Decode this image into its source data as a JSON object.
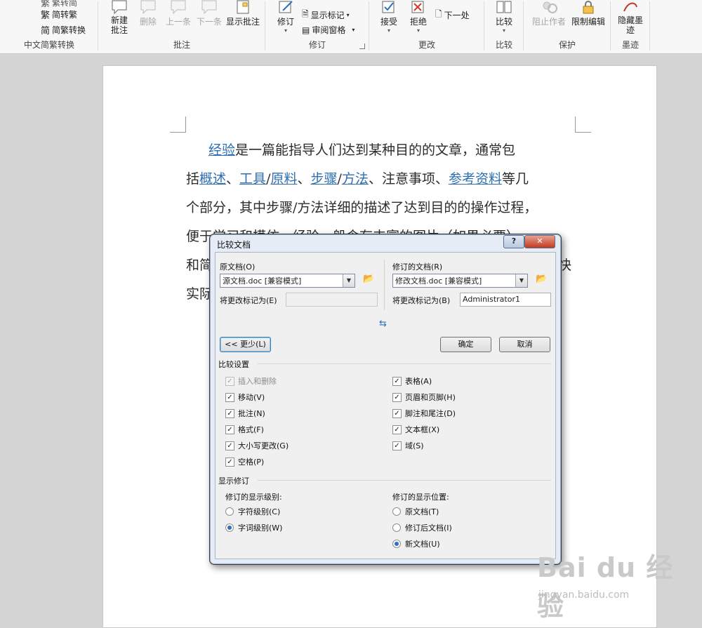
{
  "ribbon": {
    "lang": {
      "label": "中文简繁转换",
      "row1": "简转繁",
      "row2": "简繁转换",
      "top_partial": "繁转简"
    },
    "comments": {
      "label": "批注",
      "new_comment": "新建\n批注",
      "delete": "删除",
      "prev": "上一条",
      "next": "下一条",
      "show": "显示批注"
    },
    "tracking": {
      "label": "修订",
      "track": "修订",
      "show_markup": "显示标记",
      "review_pane": "审阅窗格"
    },
    "changes": {
      "label": "更改",
      "accept": "接受",
      "reject": "拒绝",
      "next": "下一处"
    },
    "compare": {
      "label": "比较",
      "compare": "比较"
    },
    "protect": {
      "label": "保护",
      "block_authors": "阻止作者",
      "restrict": "限制编辑"
    },
    "ink": {
      "label": "墨迹",
      "hide": "隐藏墨\n迹"
    }
  },
  "document": {
    "line1": {
      "link1": "经验",
      "text": "是一篇能指导人们达到某种目的的文章，通常包"
    },
    "line2": {
      "t0": "括",
      "l1": "概述",
      "t1": "、",
      "l2": "工具",
      "t2": "/",
      "l3": "原料",
      "t3": "、",
      "l4": "步骤",
      "t4": "/",
      "l5": "方法",
      "t5": "、注意事项、",
      "l6": "参考资料",
      "t6": "等几"
    },
    "line3": "个部分，其中步骤/方法详细的描述了达到目的的操作过程，",
    "line4": "便于学习和模仿。经验一般含有丰富的图片（如果必要），",
    "line5a": "和简",
    "line5b": "快",
    "line6": "实际"
  },
  "dialog": {
    "title": "比较文档",
    "help": "?",
    "close": "✕",
    "original_label": "原文档(O)",
    "original_value": "源文档.doc [兼容模式]",
    "original_mark_label": "将更改标记为(E)",
    "original_mark_value": "",
    "revised_label": "修订的文档(R)",
    "revised_value": "修改文档.doc [兼容模式]",
    "revised_mark_label": "将更改标记为(B)",
    "revised_mark_value": "Administrator1",
    "less_button": "<< 更少(L)",
    "ok": "确定",
    "cancel": "取消",
    "settings_title": "比较设置",
    "settings_left": [
      {
        "label": "插入和删除",
        "checked": true,
        "disabled": true
      },
      {
        "label": "移动(V)",
        "checked": true
      },
      {
        "label": "批注(N)",
        "checked": true
      },
      {
        "label": "格式(F)",
        "checked": true
      },
      {
        "label": "大小写更改(G)",
        "checked": true
      },
      {
        "label": "空格(P)",
        "checked": true
      }
    ],
    "settings_right": [
      {
        "label": "表格(A)",
        "checked": true
      },
      {
        "label": "页眉和页脚(H)",
        "checked": true
      },
      {
        "label": "脚注和尾注(D)",
        "checked": true
      },
      {
        "label": "文本框(X)",
        "checked": true
      },
      {
        "label": "域(S)",
        "checked": true
      }
    ],
    "show_title": "显示修订",
    "level_title": "修订的显示级别:",
    "level_options": [
      {
        "label": "字符级别(C)",
        "selected": false
      },
      {
        "label": "字词级别(W)",
        "selected": true
      }
    ],
    "location_title": "修订的显示位置:",
    "location_options": [
      {
        "label": "原文档(T)",
        "selected": false
      },
      {
        "label": "修订后文档(I)",
        "selected": false
      },
      {
        "label": "新文档(U)",
        "selected": true
      }
    ]
  },
  "watermark": {
    "logo": "Bai du 经验",
    "url": "jingyan.baidu.com"
  }
}
